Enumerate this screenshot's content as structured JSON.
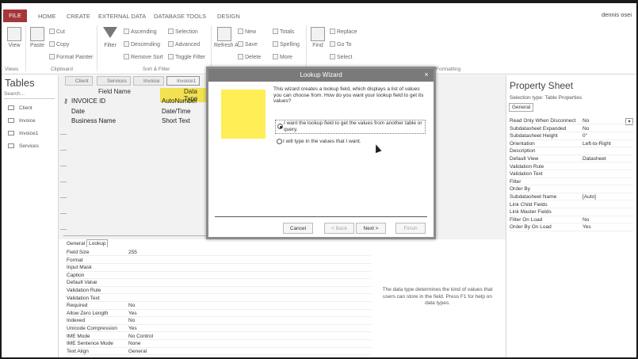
{
  "ribbon_tabs": [
    "HOME",
    "CREATE",
    "EXTERNAL DATA",
    "DATABASE TOOLS",
    "DESIGN"
  ],
  "file_tab": "FILE",
  "user_name": "dennis osei",
  "ribbon": {
    "view": "View",
    "paste": "Paste",
    "cut": "Cut",
    "copy": "Copy",
    "format_painter": "Format Painter",
    "filter": "Filter",
    "ascending": "Ascending",
    "descending": "Descending",
    "remove_sort": "Remove Sort",
    "selection": "Selection",
    "advanced": "Advanced",
    "toggle_filter": "Toggle Filter",
    "refresh_all": "Refresh All",
    "new": "New",
    "save": "Save",
    "delete": "Delete",
    "totals": "Totals",
    "spelling": "Spelling",
    "more": "More",
    "find": "Find",
    "replace": "Replace",
    "go_to": "Go To",
    "select": "Select",
    "groups": [
      "Views",
      "Clipboard",
      "Sort & Filter",
      "Formatting"
    ]
  },
  "nav": {
    "title": "Tables",
    "search": "Search...",
    "items": [
      "Client",
      "Invoice",
      "Invoice1",
      "Services"
    ]
  },
  "object_tabs": [
    "Client",
    "Services",
    "Invoice",
    "Invoice1"
  ],
  "grid": {
    "headers": [
      "Field Name",
      "Data Type"
    ],
    "rows": [
      {
        "name": "INVOICE ID",
        "type": "AutoNumber"
      },
      {
        "name": "Date",
        "type": "Date/Time"
      },
      {
        "name": "Business Name",
        "type": "Short Text"
      }
    ]
  },
  "field_props": {
    "tabs": [
      "General",
      "Lookup"
    ],
    "rows": [
      {
        "name": "Field Size",
        "value": "255"
      },
      {
        "name": "Format",
        "value": ""
      },
      {
        "name": "Input Mask",
        "value": ""
      },
      {
        "name": "Caption",
        "value": ""
      },
      {
        "name": "Default Value",
        "value": ""
      },
      {
        "name": "Validation Rule",
        "value": ""
      },
      {
        "name": "Validation Text",
        "value": ""
      },
      {
        "name": "Required",
        "value": "No"
      },
      {
        "name": "Allow Zero Length",
        "value": "Yes"
      },
      {
        "name": "Indexed",
        "value": "No"
      },
      {
        "name": "Unicode Compression",
        "value": "Yes"
      },
      {
        "name": "IME Mode",
        "value": "No Control"
      },
      {
        "name": "IME Sentence Mode",
        "value": "None"
      },
      {
        "name": "Text Align",
        "value": "General"
      }
    ],
    "hint": "The data type determines the kind of values that users can store in the field. Press F1 for help on data types."
  },
  "property_sheet": {
    "title": "Property Sheet",
    "selection_type": "Selection type:  Table Properties",
    "tab": "General",
    "rows": [
      {
        "name": "Read Only When Disconnect",
        "value": "No"
      },
      {
        "name": "Subdatasheet Expanded",
        "value": "No"
      },
      {
        "name": "Subdatasheet Height",
        "value": "0\""
      },
      {
        "name": "Orientation",
        "value": "Left-to-Right"
      },
      {
        "name": "Description",
        "value": ""
      },
      {
        "name": "Default View",
        "value": "Datasheet"
      },
      {
        "name": "Validation Rule",
        "value": ""
      },
      {
        "name": "Validation Text",
        "value": ""
      },
      {
        "name": "Filter",
        "value": ""
      },
      {
        "name": "Order By",
        "value": ""
      },
      {
        "name": "Subdatasheet Name",
        "value": "[Auto]"
      },
      {
        "name": "Link Child Fields",
        "value": ""
      },
      {
        "name": "Link Master Fields",
        "value": ""
      },
      {
        "name": "Filter On Load",
        "value": "No"
      },
      {
        "name": "Order By On Load",
        "value": "Yes"
      }
    ]
  },
  "wizard": {
    "title": "Lookup Wizard",
    "description": "This wizard creates a lookup field, which displays a list of values you can choose from.  How do you want your lookup field to get its values?",
    "option1": "I want the lookup field to get the values from another table or query.",
    "option2": "I will type in the values that I want.",
    "buttons": {
      "cancel": "Cancel",
      "back": "< Back",
      "next": "Next >",
      "finish": "Finish"
    },
    "image_color": "#ffee55"
  }
}
